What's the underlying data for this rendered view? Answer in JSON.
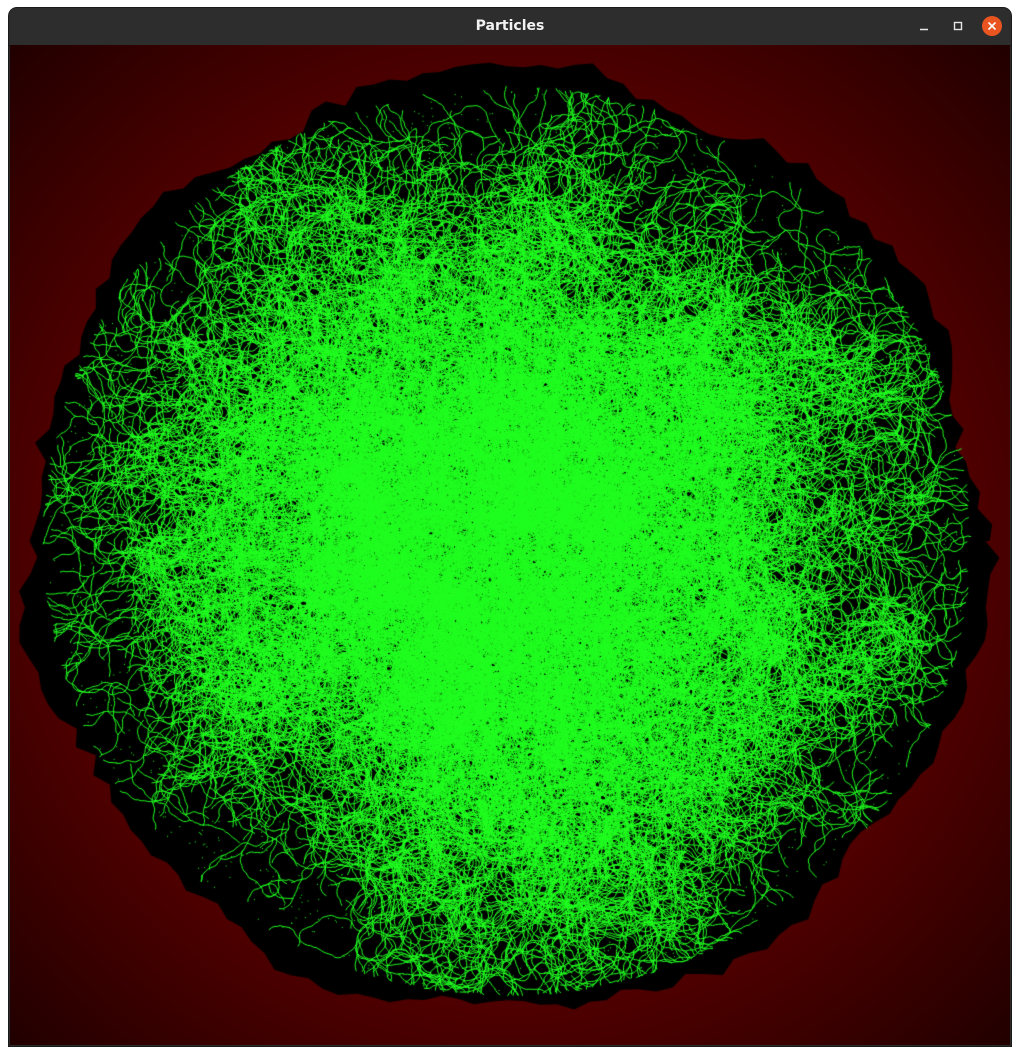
{
  "window": {
    "title": "Particles"
  },
  "colors": {
    "titlebar_bg": "#2d2d2d",
    "title_text": "#f2f2f2",
    "close_button": "#e95420",
    "background_red": "#5e0000",
    "cluster_black": "#000000",
    "particle_green": "#1fff1f"
  },
  "icons": {
    "minimize": "minimize-icon",
    "maximize": "maximize-icon",
    "close": "close-icon"
  }
}
